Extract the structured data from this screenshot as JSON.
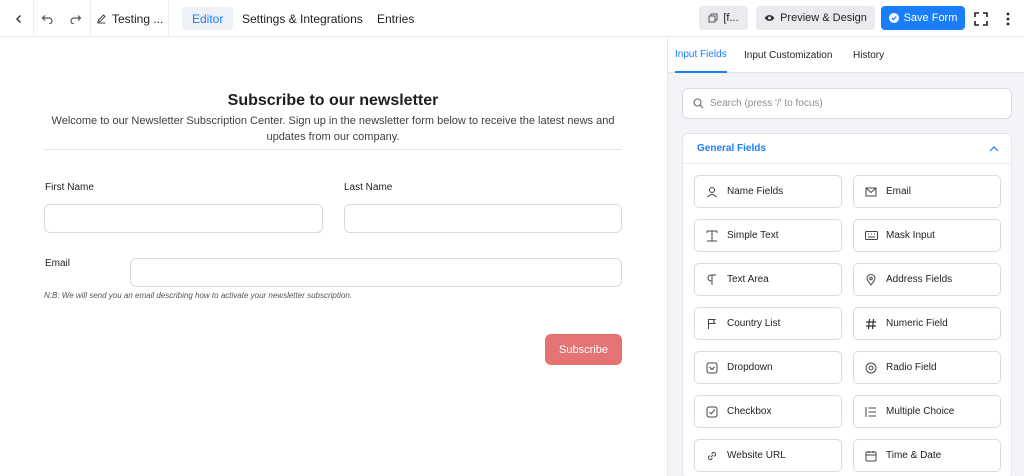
{
  "topbar": {
    "title": "Testing ...",
    "tabs": [
      {
        "label": "Editor",
        "active": true
      },
      {
        "label": "Settings & Integrations",
        "active": false
      },
      {
        "label": "Entries",
        "active": false
      }
    ],
    "shortcode_label": "[f...",
    "preview_label": "Preview & Design",
    "save_label": "Save Form",
    "accent": "#1a7efb"
  },
  "form": {
    "title": "Subscribe to our newsletter",
    "description": "Welcome to our Newsletter Subscription Center. Sign up in the newsletter form below to receive the latest news and updates from our company.",
    "first_name_label": "First Name",
    "last_name_label": "Last Name",
    "email_label": "Email",
    "help_text": "N:B: We will send you an email describing how to activate your newsletter subscription.",
    "submit_label": "Subscribe",
    "submit_color": "#e57373"
  },
  "sidebar": {
    "tabs": [
      {
        "label": "Input Fields",
        "active": true
      },
      {
        "label": "Input Customization",
        "active": false
      },
      {
        "label": "History",
        "active": false
      }
    ],
    "search_placeholder": "Search (press '/' to focus)",
    "section_title": "General Fields",
    "fields": [
      {
        "label": "Name Fields",
        "icon": "user-icon"
      },
      {
        "label": "Email",
        "icon": "envelope-icon"
      },
      {
        "label": "Simple Text",
        "icon": "text-cursor-icon"
      },
      {
        "label": "Mask Input",
        "icon": "keyboard-icon"
      },
      {
        "label": "Text Area",
        "icon": "paragraph-icon"
      },
      {
        "label": "Address Fields",
        "icon": "map-pin-icon"
      },
      {
        "label": "Country List",
        "icon": "flag-icon"
      },
      {
        "label": "Numeric Field",
        "icon": "hash-icon"
      },
      {
        "label": "Dropdown",
        "icon": "dropdown-icon"
      },
      {
        "label": "Radio Field",
        "icon": "radio-icon"
      },
      {
        "label": "Checkbox",
        "icon": "checkbox-icon"
      },
      {
        "label": "Multiple Choice",
        "icon": "list-icon"
      },
      {
        "label": "Website URL",
        "icon": "link-icon"
      },
      {
        "label": "Time & Date",
        "icon": "calendar-icon"
      }
    ]
  }
}
